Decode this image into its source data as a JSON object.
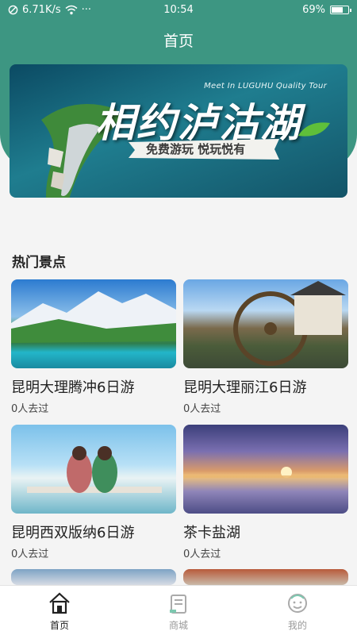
{
  "status_bar": {
    "network_speed": "6.71K/s",
    "more": "···",
    "time": "10:54",
    "battery": "69%",
    "battery_level": 0.69
  },
  "header": {
    "title": "首页"
  },
  "banner": {
    "title_en": "Meet In LUGUHU Quality Tour",
    "title_cn": "相约泸沽湖",
    "subtitle": "免费游玩 悦玩悦有"
  },
  "section": {
    "title": "热门景点"
  },
  "spots": [
    {
      "name": "昆明大理腾冲6日游",
      "count": "0人去过"
    },
    {
      "name": "昆明大理丽江6日游",
      "count": "0人去过"
    },
    {
      "name": "昆明西双版纳6日游",
      "count": "0人去过"
    },
    {
      "name": "茶卡盐湖",
      "count": "0人去过"
    }
  ],
  "tabbar": {
    "home_label": "首页",
    "mall_label": "商城",
    "mine_label": "我的"
  },
  "colors": {
    "primary": "#3d9682",
    "background": "#f4f4f4",
    "tab_inactive": "#999999"
  }
}
